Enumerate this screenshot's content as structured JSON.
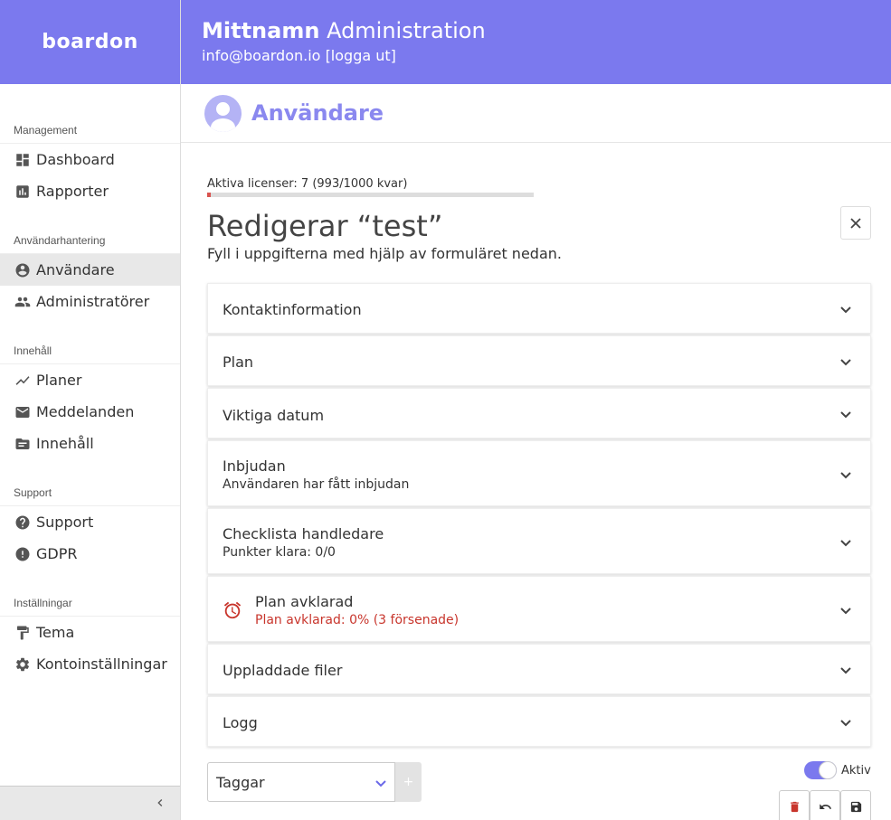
{
  "brand": {
    "logo_text": "boardon",
    "accent": "#7b79ee"
  },
  "header": {
    "title_bold": "Mittnamn",
    "title_rest": " Administration",
    "email": "info@boardon.io",
    "logout": "[logga ut]"
  },
  "sidebar": {
    "sections": [
      {
        "label": "Management",
        "items": [
          {
            "label": "Dashboard",
            "icon": "dashboard-icon"
          },
          {
            "label": "Rapporter",
            "icon": "bar-chart-icon"
          }
        ]
      },
      {
        "label": "Användarhantering",
        "items": [
          {
            "label": "Användare",
            "icon": "user-circle-icon",
            "active": true
          },
          {
            "label": "Administratörer",
            "icon": "group-icon"
          }
        ]
      },
      {
        "label": "Innehåll",
        "items": [
          {
            "label": "Planer",
            "icon": "trend-line-icon"
          },
          {
            "label": "Meddelanden",
            "icon": "mail-icon"
          },
          {
            "label": "Innehåll",
            "icon": "folder-icon"
          }
        ]
      },
      {
        "label": "Support",
        "items": [
          {
            "label": "Support",
            "icon": "help-circle-icon"
          },
          {
            "label": "GDPR",
            "icon": "alert-circle-icon"
          }
        ]
      },
      {
        "label": "Inställningar",
        "items": [
          {
            "label": "Tema",
            "icon": "paint-roller-icon"
          },
          {
            "label": "Kontoinställningar",
            "icon": "gear-icon"
          }
        ]
      }
    ]
  },
  "page": {
    "title": "Användare"
  },
  "licenses": {
    "text": "Aktiva licenser: 7 (993/1000 kvar)",
    "used_fraction": 0.007
  },
  "edit": {
    "title": "Redigerar “test”",
    "subtitle": "Fyll i uppgifterna med hjälp av formuläret nedan."
  },
  "panels": [
    {
      "title": "Kontaktinformation"
    },
    {
      "title": "Plan"
    },
    {
      "title": "Viktiga datum"
    },
    {
      "title": "Inbjudan",
      "subtitle": "Användaren har fått inbjudan"
    },
    {
      "title": "Checklista handledare",
      "subtitle": "Punkter klara: 0/0"
    },
    {
      "title": "Plan avklarad",
      "subtitle": "Plan avklarad: 0% (3 försenade)",
      "warning": true
    },
    {
      "title": "Uppladdade filer"
    },
    {
      "title": "Logg"
    }
  ],
  "tags": {
    "placeholder": "Taggar",
    "add_label": "+"
  },
  "status": {
    "toggle_label": "Aktiv",
    "active": true
  }
}
